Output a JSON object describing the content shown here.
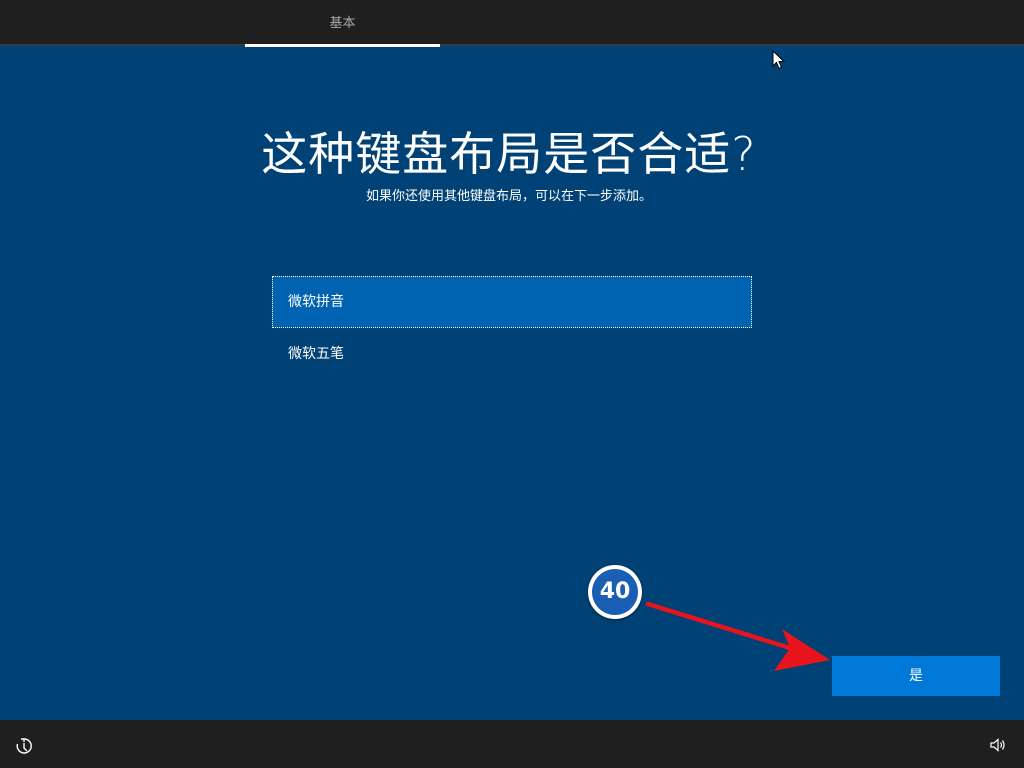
{
  "header": {
    "tab_label": "基本"
  },
  "main": {
    "title": "这种键盘布局是否合适?",
    "subtitle": "如果你还使用其他键盘布局，可以在下一步添加。",
    "options": [
      {
        "label": "微软拼音",
        "selected": true
      },
      {
        "label": "微软五笔",
        "selected": false
      }
    ],
    "yes_label": "是"
  },
  "annotation": {
    "step_number": "40"
  },
  "colors": {
    "background": "#004275",
    "selected_item": "#0063b1",
    "primary_button": "#0078d7",
    "bar": "#1f1f1f",
    "arrow": "#e8141c",
    "badge": "#1a5fb4"
  },
  "icons": {
    "bottom_left": "ease-of-access-icon",
    "bottom_right": "volume-icon",
    "pointer": "mouse-cursor-icon"
  }
}
